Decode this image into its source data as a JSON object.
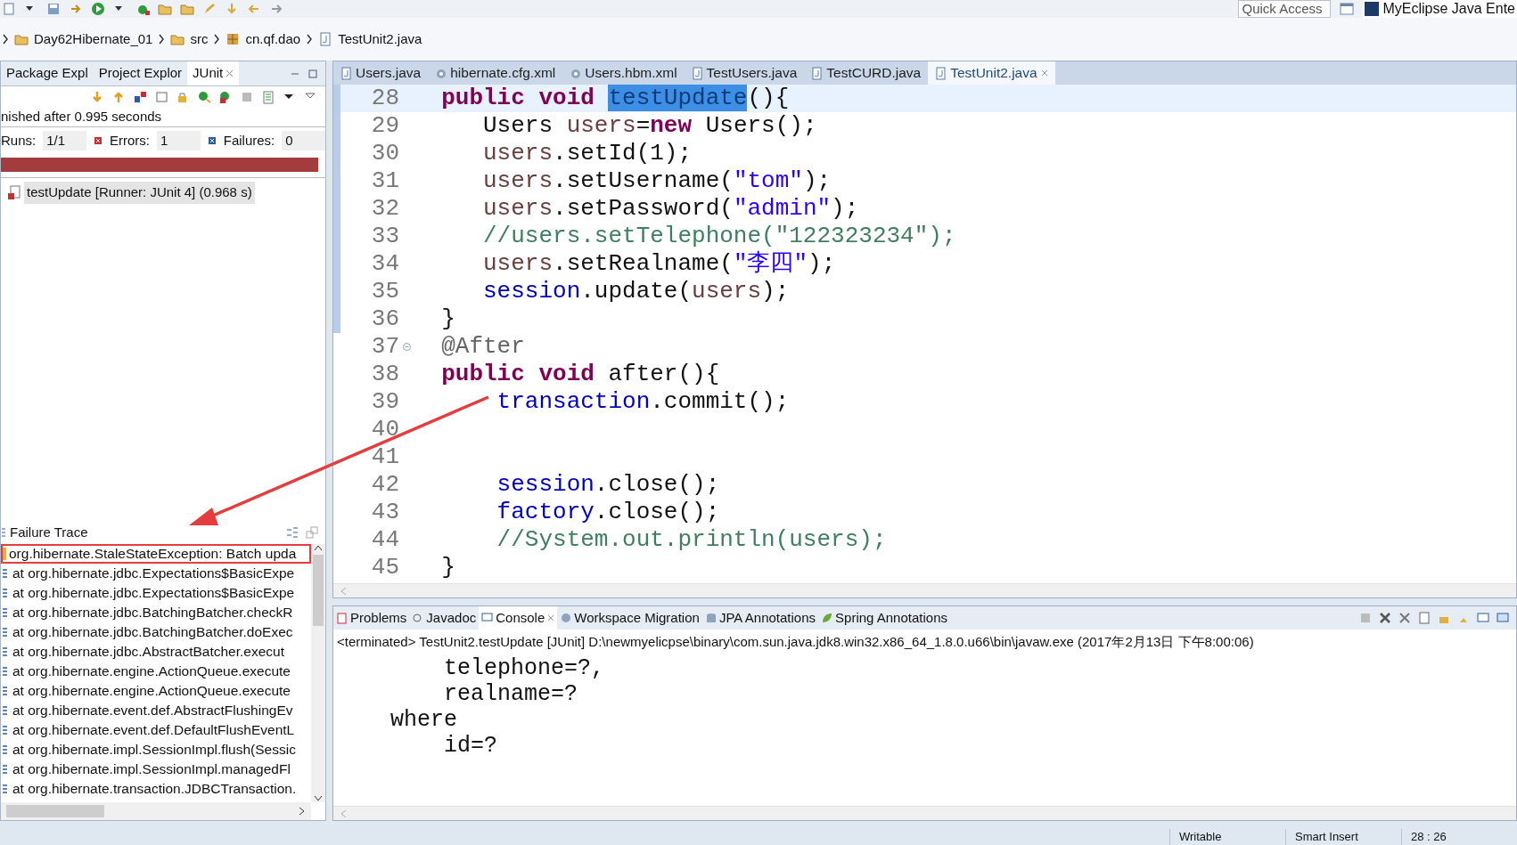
{
  "toolbar": {
    "quick_access": {
      "placeholder": "Quick Access"
    },
    "perspective": "MyEclipse Java Ente"
  },
  "breadcrumb": [
    {
      "label": "Day62Hibernate_01",
      "kind": "project"
    },
    {
      "label": "src",
      "kind": "folder"
    },
    {
      "label": "cn.qf.dao",
      "kind": "package"
    },
    {
      "label": "TestUnit2.java",
      "kind": "file"
    }
  ],
  "left_panel": {
    "tabs": [
      {
        "label": "Package Expl",
        "selected": false
      },
      {
        "label": "Project Explor",
        "selected": false
      },
      {
        "label": "JUnit",
        "selected": true
      }
    ],
    "status": "nished after 0.995 seconds",
    "counters": [
      {
        "label": "Runs:",
        "value": "1/1",
        "kind": "runs"
      },
      {
        "label": "Errors:",
        "value": "1",
        "kind": "errors"
      },
      {
        "label": "Failures:",
        "value": "0",
        "kind": "failures"
      }
    ],
    "progress": {
      "level": 1,
      "failed": true
    },
    "tests": [
      {
        "label": "testUpdate [Runner: JUnit 4] (0.968 s)",
        "selected": true
      }
    ],
    "failure_trace": {
      "title": "Failure Trace",
      "lines": [
        {
          "text": "org.hibernate.StaleStateException: Batch upda",
          "kind": "exception",
          "highlighted": true
        },
        {
          "text": "at org.hibernate.jdbc.Expectations$BasicExpe",
          "kind": "frame",
          "highlighted": false
        },
        {
          "text": "at org.hibernate.jdbc.Expectations$BasicExpe",
          "kind": "frame",
          "highlighted": false
        },
        {
          "text": "at org.hibernate.jdbc.BatchingBatcher.checkR",
          "kind": "frame",
          "highlighted": false
        },
        {
          "text": "at org.hibernate.jdbc.BatchingBatcher.doExec",
          "kind": "frame",
          "highlighted": false
        },
        {
          "text": "at org.hibernate.jdbc.AbstractBatcher.execut",
          "kind": "frame",
          "highlighted": false
        },
        {
          "text": "at org.hibernate.engine.ActionQueue.execute",
          "kind": "frame",
          "highlighted": false
        },
        {
          "text": "at org.hibernate.engine.ActionQueue.execute",
          "kind": "frame",
          "highlighted": false
        },
        {
          "text": "at org.hibernate.event.def.AbstractFlushingEv",
          "kind": "frame",
          "highlighted": false
        },
        {
          "text": "at org.hibernate.event.def.DefaultFlushEventL",
          "kind": "frame",
          "highlighted": false
        },
        {
          "text": "at org.hibernate.impl.SessionImpl.flush(Sessic",
          "kind": "frame",
          "highlighted": false
        },
        {
          "text": "at org.hibernate.impl.SessionImpl.managedFl",
          "kind": "frame",
          "highlighted": false
        },
        {
          "text": "at org.hibernate.transaction.JDBCTransaction.",
          "kind": "frame",
          "highlighted": false
        }
      ]
    }
  },
  "editor": {
    "tabs": [
      {
        "label": "Users.java",
        "kind": "java",
        "selected": false
      },
      {
        "label": "hibernate.cfg.xml",
        "kind": "xml",
        "selected": false
      },
      {
        "label": "Users.hbm.xml",
        "kind": "xml",
        "selected": false
      },
      {
        "label": "TestUsers.java",
        "kind": "java",
        "selected": false
      },
      {
        "label": "TestCURD.java",
        "kind": "java",
        "selected": false
      },
      {
        "label": "TestUnit2.java",
        "kind": "java",
        "selected": true
      }
    ],
    "lines": [
      {
        "number": "28",
        "current": true,
        "changed": true,
        "foldable": false,
        "tokens": [
          {
            "text": "  public void ",
            "kind": "keyword"
          },
          {
            "text": "testUpdate",
            "kind": "selection"
          },
          {
            "text": "(){",
            "kind": "plain"
          }
        ]
      },
      {
        "number": "29",
        "current": false,
        "changed": true,
        "foldable": false,
        "tokens": [
          {
            "text": "     Users ",
            "kind": "plain"
          },
          {
            "text": "users",
            "kind": "local"
          },
          {
            "text": "=",
            "kind": "plain"
          },
          {
            "text": "new",
            "kind": "keyword"
          },
          {
            "text": " Users();",
            "kind": "plain"
          }
        ]
      },
      {
        "number": "30",
        "current": false,
        "changed": true,
        "foldable": false,
        "tokens": [
          {
            "text": "     users",
            "kind": "local"
          },
          {
            "text": ".setId(1);",
            "kind": "plain"
          }
        ]
      },
      {
        "number": "31",
        "current": false,
        "changed": true,
        "foldable": false,
        "tokens": [
          {
            "text": "     users",
            "kind": "local"
          },
          {
            "text": ".setUsername(",
            "kind": "plain"
          },
          {
            "text": "\"tom\"",
            "kind": "string"
          },
          {
            "text": ");",
            "kind": "plain"
          }
        ]
      },
      {
        "number": "32",
        "current": false,
        "changed": true,
        "foldable": false,
        "tokens": [
          {
            "text": "     users",
            "kind": "local"
          },
          {
            "text": ".setPassword(",
            "kind": "plain"
          },
          {
            "text": "\"admin\"",
            "kind": "string"
          },
          {
            "text": ");",
            "kind": "plain"
          }
        ]
      },
      {
        "number": "33",
        "current": false,
        "changed": true,
        "foldable": false,
        "tokens": [
          {
            "text": "     //users.setTelephone(\"122323234\");",
            "kind": "comment"
          }
        ]
      },
      {
        "number": "34",
        "current": false,
        "changed": true,
        "foldable": false,
        "tokens": [
          {
            "text": "     users",
            "kind": "local"
          },
          {
            "text": ".setRealname(",
            "kind": "plain"
          },
          {
            "text": "\"李四\"",
            "kind": "string"
          },
          {
            "text": ");",
            "kind": "plain"
          }
        ]
      },
      {
        "number": "35",
        "current": false,
        "changed": true,
        "foldable": false,
        "tokens": [
          {
            "text": "     session",
            "kind": "field"
          },
          {
            "text": ".update(",
            "kind": "plain"
          },
          {
            "text": "users",
            "kind": "local"
          },
          {
            "text": ");",
            "kind": "plain"
          }
        ]
      },
      {
        "number": "36",
        "current": false,
        "changed": true,
        "foldable": false,
        "tokens": [
          {
            "text": "  }",
            "kind": "plain"
          }
        ]
      },
      {
        "number": "37",
        "current": false,
        "changed": false,
        "foldable": true,
        "tokens": [
          {
            "text": "  @After",
            "kind": "annotation"
          }
        ]
      },
      {
        "number": "38",
        "current": false,
        "changed": false,
        "foldable": false,
        "tokens": [
          {
            "text": "  public void",
            "kind": "keyword"
          },
          {
            "text": " after(){",
            "kind": "plain"
          }
        ]
      },
      {
        "number": "39",
        "current": false,
        "changed": false,
        "foldable": false,
        "tokens": [
          {
            "text": "      transaction",
            "kind": "field"
          },
          {
            "text": ".commit();",
            "kind": "plain"
          }
        ]
      },
      {
        "number": "40",
        "current": false,
        "changed": false,
        "foldable": false
      },
      {
        "number": "41",
        "current": false,
        "changed": false,
        "foldable": false
      },
      {
        "number": "42",
        "current": false,
        "changed": false,
        "foldable": false,
        "tokens": [
          {
            "text": "      session",
            "kind": "field"
          },
          {
            "text": ".close();",
            "kind": "plain"
          }
        ]
      },
      {
        "number": "43",
        "current": false,
        "changed": false,
        "foldable": false,
        "tokens": [
          {
            "text": "      factory",
            "kind": "field"
          },
          {
            "text": ".close();",
            "kind": "plain"
          }
        ]
      },
      {
        "number": "44",
        "current": false,
        "changed": false,
        "foldable": false,
        "tokens": [
          {
            "text": "      //System.out.println(users);",
            "kind": "comment"
          }
        ]
      },
      {
        "number": "45",
        "current": false,
        "changed": false,
        "foldable": false,
        "tokens": [
          {
            "text": "  }",
            "kind": "plain"
          }
        ]
      }
    ]
  },
  "console": {
    "tabs": [
      {
        "label": "Problems",
        "kind": "problems",
        "selected": false
      },
      {
        "label": "Javadoc",
        "kind": "javadoc",
        "selected": false
      },
      {
        "label": "Console",
        "kind": "console",
        "selected": true
      },
      {
        "label": "Workspace Migration",
        "kind": "migration",
        "selected": false
      },
      {
        "label": "JPA Annotations",
        "kind": "jpa",
        "selected": false
      },
      {
        "label": "Spring Annotations",
        "kind": "spring",
        "selected": false
      }
    ],
    "header": "<terminated> TestUnit2.testUpdate [JUnit] D:\\newmyelicpse\\binary\\com.sun.java.jdk8.win32.x86_64_1.8.0.u66\\bin\\javaw.exe (2017年2月13日 下午8:00:06)",
    "lines": [
      "        telephone=?,",
      "        realname=?",
      "    where",
      "        id=?"
    ]
  },
  "status_bar": [
    "Writable",
    "Smart Insert",
    "28 : 26"
  ]
}
